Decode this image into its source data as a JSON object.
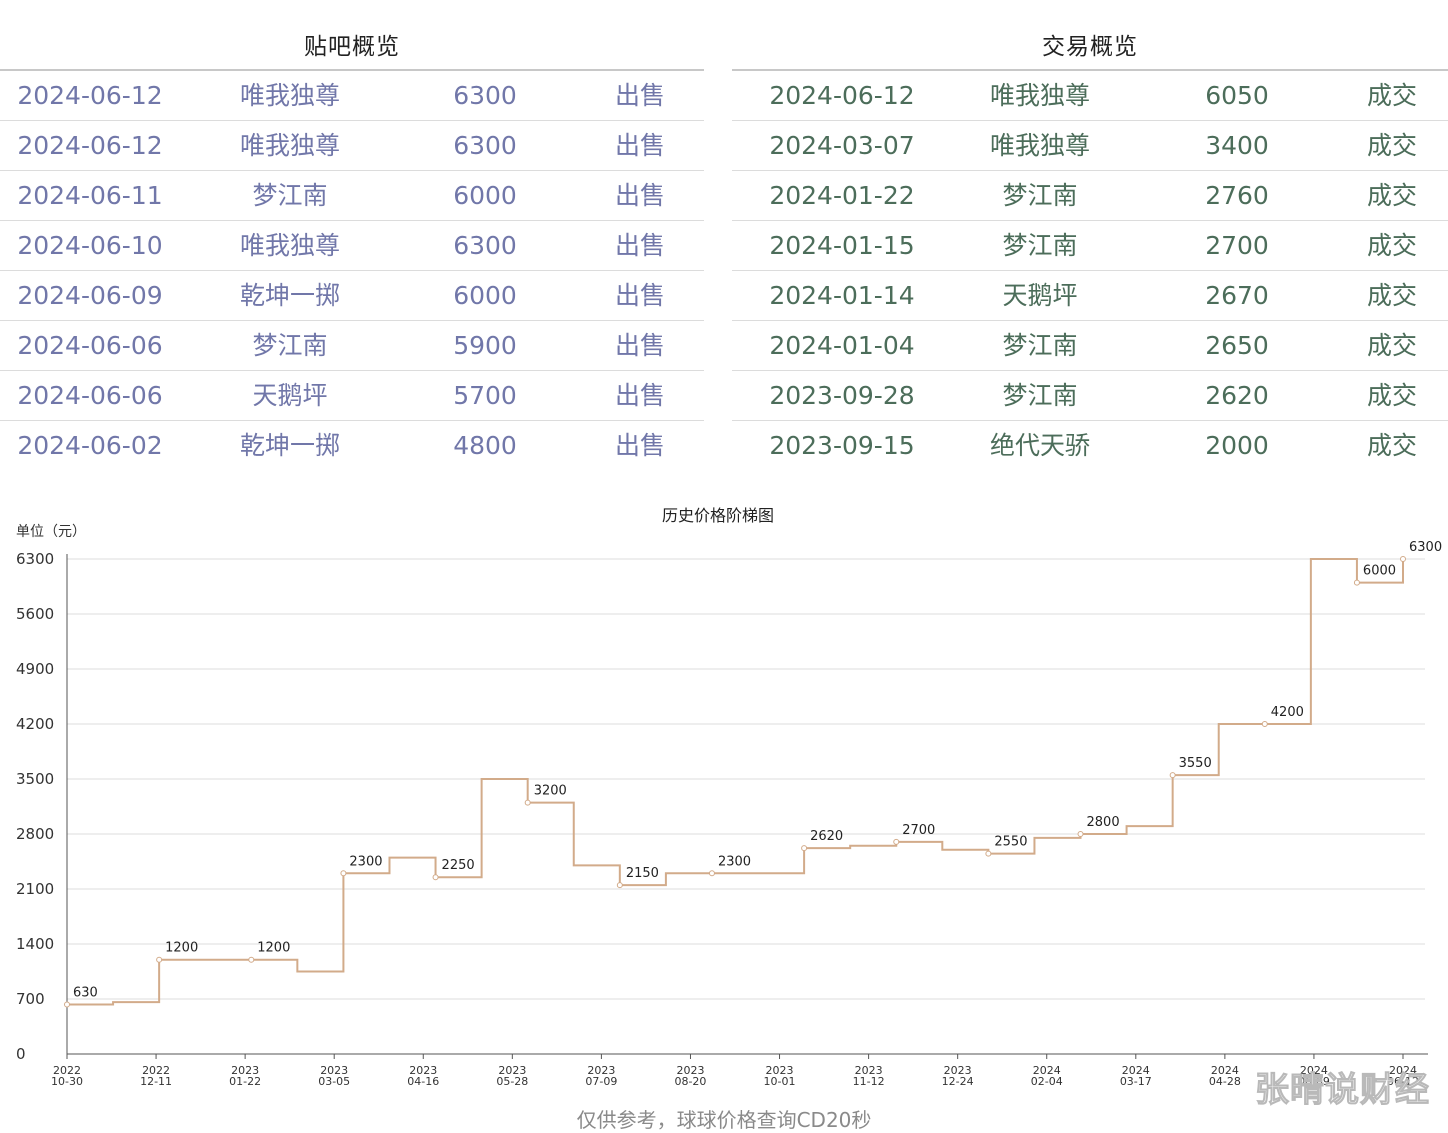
{
  "tieba": {
    "title": "贴吧概览",
    "rows": [
      {
        "date": "2024-06-12",
        "name": "唯我独尊",
        "price": "6300",
        "type": "出售"
      },
      {
        "date": "2024-06-12",
        "name": "唯我独尊",
        "price": "6300",
        "type": "出售"
      },
      {
        "date": "2024-06-11",
        "name": "梦江南",
        "price": "6000",
        "type": "出售"
      },
      {
        "date": "2024-06-10",
        "name": "唯我独尊",
        "price": "6300",
        "type": "出售"
      },
      {
        "date": "2024-06-09",
        "name": "乾坤一掷",
        "price": "6000",
        "type": "出售"
      },
      {
        "date": "2024-06-06",
        "name": "梦江南",
        "price": "5900",
        "type": "出售"
      },
      {
        "date": "2024-06-06",
        "name": "天鹅坪",
        "price": "5700",
        "type": "出售"
      },
      {
        "date": "2024-06-02",
        "name": "乾坤一掷",
        "price": "4800",
        "type": "出售"
      }
    ]
  },
  "trade": {
    "title": "交易概览",
    "rows": [
      {
        "date": "2024-06-12",
        "name": "唯我独尊",
        "price": "6050",
        "type": "成交"
      },
      {
        "date": "2024-03-07",
        "name": "唯我独尊",
        "price": "3400",
        "type": "成交"
      },
      {
        "date": "2024-01-22",
        "name": "梦江南",
        "price": "2760",
        "type": "成交"
      },
      {
        "date": "2024-01-15",
        "name": "梦江南",
        "price": "2700",
        "type": "成交"
      },
      {
        "date": "2024-01-14",
        "name": "天鹅坪",
        "price": "2670",
        "type": "成交"
      },
      {
        "date": "2024-01-04",
        "name": "梦江南",
        "price": "2650",
        "type": "成交"
      },
      {
        "date": "2023-09-28",
        "name": "梦江南",
        "price": "2620",
        "type": "成交"
      },
      {
        "date": "2023-09-15",
        "name": "绝代天骄",
        "price": "2000",
        "type": "成交"
      }
    ]
  },
  "chart_data": {
    "type": "line",
    "step": true,
    "title": "历史价格阶梯图",
    "ylabel": "单位（元）",
    "ylim": [
      0,
      6300
    ],
    "yticks": [
      0,
      700,
      1400,
      2100,
      2800,
      3500,
      4200,
      4900,
      5600,
      6300
    ],
    "xticks": [
      [
        "2022",
        "10-30"
      ],
      [
        "2022",
        "12-11"
      ],
      [
        "2023",
        "01-22"
      ],
      [
        "2023",
        "03-05"
      ],
      [
        "2023",
        "04-16"
      ],
      [
        "2023",
        "05-28"
      ],
      [
        "2023",
        "07-09"
      ],
      [
        "2023",
        "08-20"
      ],
      [
        "2023",
        "10-01"
      ],
      [
        "2023",
        "11-12"
      ],
      [
        "2023",
        "12-24"
      ],
      [
        "2024",
        "02-04"
      ],
      [
        "2024",
        "03-17"
      ],
      [
        "2024",
        "04-28"
      ],
      [
        "2024",
        "06-09"
      ],
      [
        "2024",
        "06-12"
      ]
    ],
    "line_color": "#d2ab8a",
    "grid": true,
    "series": [
      {
        "values": [
          630,
          660,
          1200,
          1200,
          1200,
          1050,
          2300,
          2500,
          2250,
          3500,
          3200,
          2400,
          2150,
          2300,
          2300,
          2300,
          2620,
          2650,
          2700,
          2600,
          2550,
          2750,
          2800,
          2900,
          3550,
          4200,
          4200,
          6300,
          6000,
          6300
        ],
        "point_labels": [
          "630",
          "",
          "1200",
          "",
          "1200",
          "",
          "2300",
          "",
          "2250",
          "",
          "3200",
          "",
          "2150",
          "",
          "2300",
          "",
          "2620",
          "",
          "2700",
          "",
          "2550",
          "",
          "2800",
          "",
          "3550",
          "",
          "4200",
          "",
          "6000",
          "6300"
        ]
      }
    ]
  },
  "footer": "仅供参考，球球价格查询CD20秒",
  "watermark": "张晴说财经"
}
